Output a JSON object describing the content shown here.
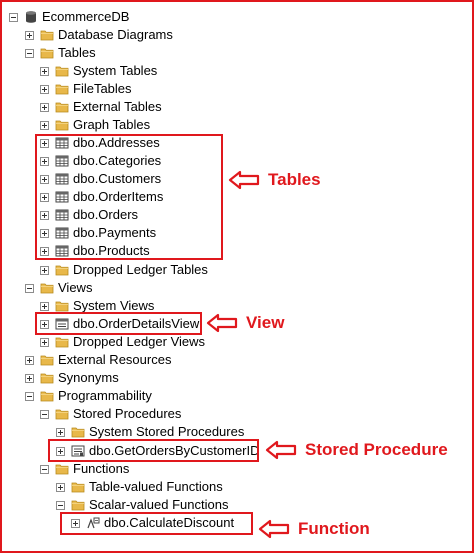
{
  "tree": {
    "db": "EcommerceDB",
    "database_diagrams": "Database Diagrams",
    "tables": "Tables",
    "system_tables": "System Tables",
    "file_tables": "FileTables",
    "external_tables": "External Tables",
    "graph_tables": "Graph Tables",
    "t_addresses": "dbo.Addresses",
    "t_categories": "dbo.Categories",
    "t_customers": "dbo.Customers",
    "t_orderitems": "dbo.OrderItems",
    "t_orders": "dbo.Orders",
    "t_payments": "dbo.Payments",
    "t_products": "dbo.Products",
    "dropped_ledger_tables": "Dropped Ledger Tables",
    "views": "Views",
    "system_views": "System Views",
    "v_orderdetails": "dbo.OrderDetailsView",
    "dropped_ledger_views": "Dropped Ledger Views",
    "external_resources": "External Resources",
    "synonyms": "Synonyms",
    "programmability": "Programmability",
    "stored_procedures": "Stored Procedures",
    "system_stored_procedures": "System Stored Procedures",
    "sp_getorders": "dbo.GetOrdersByCustomerID",
    "functions": "Functions",
    "table_valued_functions": "Table-valued Functions",
    "scalar_valued_functions": "Scalar-valued Functions",
    "fn_calculatediscount": "dbo.CalculateDiscount"
  },
  "callouts": {
    "tables": "Tables",
    "view": "View",
    "stored_procedure": "Stored Procedure",
    "function": "Function"
  },
  "colors": {
    "accent": "#e0181d",
    "folder": "#e8b84a"
  }
}
